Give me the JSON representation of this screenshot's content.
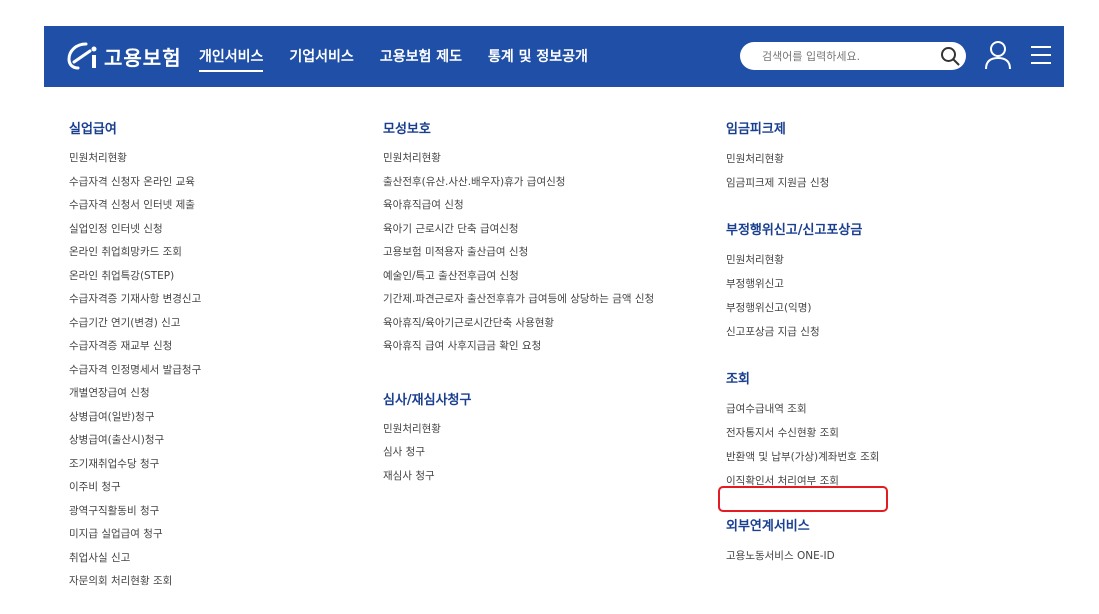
{
  "header": {
    "logo_text": "고용보험",
    "nav": [
      "개인서비스",
      "기업서비스",
      "고용보험 제도",
      "통계 및 정보공개"
    ],
    "search_placeholder": "검색어를 입력하세요.",
    "colors": {
      "header_bg": "#1f4fa6",
      "title": "#1a3f8f",
      "highlight": "#e31b23"
    }
  },
  "columns": [
    {
      "groups": [
        {
          "title": "실업급여",
          "items": [
            "민원처리현황",
            "수급자격 신청자 온라인 교육",
            "수급자격 신청서 인터넷 제출",
            "실업인정 인터넷 신청",
            "온라인 취업희망카드 조회",
            "온라인 취업특강(STEP)",
            "수급자격증 기재사항 변경신고",
            "수급기간 연기(변경) 신고",
            "수급자격증 재교부 신청",
            "수급자격 인정명세서 발급청구",
            "개별연장급여 신청",
            "상병급여(일반)청구",
            "상병급여(출산시)청구",
            "조기재취업수당 청구",
            "이주비 청구",
            "광역구직활동비 청구",
            "미지급 실업급여 청구",
            "취업사실 신고",
            "자문의회 처리현황 조회"
          ]
        }
      ]
    },
    {
      "groups": [
        {
          "title": "모성보호",
          "items": [
            "민원처리현황",
            "출산전후(유산.사산.배우자)휴가 급여신청",
            "육아휴직급여 신청",
            "육아기 근로시간 단축 급여신청",
            "고용보험 미적용자 출산급여 신청",
            "예술인/특고 출산전후급여 신청",
            "기간제.파견근로자 출산전후휴가 급여등에 상당하는 금액 신청",
            "육아휴직/육아기근로시간단축 사용현황",
            "육아휴직 급여 사후지급금 확인 요청"
          ]
        },
        {
          "title": "심사/재심사청구",
          "items": [
            "민원처리현황",
            "심사 청구",
            "재심사 청구"
          ]
        }
      ]
    },
    {
      "groups": [
        {
          "title": "임금피크제",
          "items": [
            "민원처리현황",
            "임금피크제 지원금 신청"
          ]
        },
        {
          "title": "부정행위신고/신고포상금",
          "items": [
            "민원처리현황",
            "부정행위신고",
            "부정행위신고(익명)",
            "신고포상금 지급 신청"
          ]
        },
        {
          "title": "조회",
          "items": [
            "급여수급내역 조회",
            "전자통지서 수신현황 조회",
            "반환액 및 납부(가상)계좌번호 조회",
            "이직확인서 처리여부 조회"
          ]
        },
        {
          "title": "외부연계서비스",
          "items": [
            "고용노동서비스 ONE-ID"
          ]
        }
      ]
    }
  ]
}
